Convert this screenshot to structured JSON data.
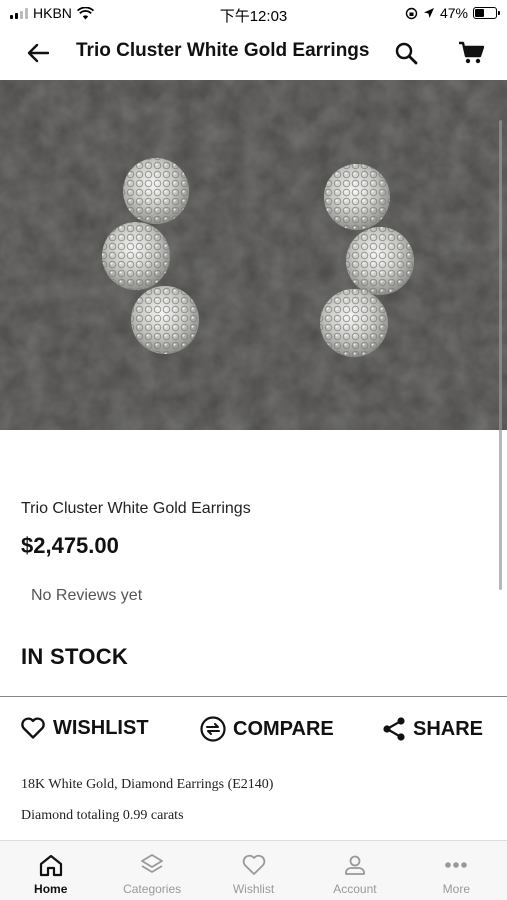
{
  "status_bar": {
    "carrier": "HKBN",
    "time": "下午12:03",
    "battery": "47%",
    "battery_level": 0.47
  },
  "nav": {
    "title": "Trio Cluster White Gold Earrings"
  },
  "product": {
    "name": "Trio Cluster White Gold Earrings",
    "price": "$2,475.00",
    "reviews": "No Reviews yet",
    "stock": "IN STOCK",
    "description": [
      "18K White Gold, Diamond Earrings (E2140)",
      "Diamond totaling 0.99 carats"
    ]
  },
  "actions": {
    "wishlist": "WISHLIST",
    "compare": "COMPARE",
    "share": "SHARE"
  },
  "tabs": [
    {
      "label": "Home",
      "icon": "home-icon",
      "active": true
    },
    {
      "label": "Categories",
      "icon": "layers-icon",
      "active": false
    },
    {
      "label": "Wishlist",
      "icon": "heart-icon",
      "active": false
    },
    {
      "label": "Account",
      "icon": "person-icon",
      "active": false
    },
    {
      "label": "More",
      "icon": "more-dots-icon",
      "active": false
    }
  ],
  "colors": {
    "image_background": "#4a4947",
    "text": "#111111",
    "tab_inactive": "#999999",
    "tab_bar_background": "#f7f7f7"
  }
}
